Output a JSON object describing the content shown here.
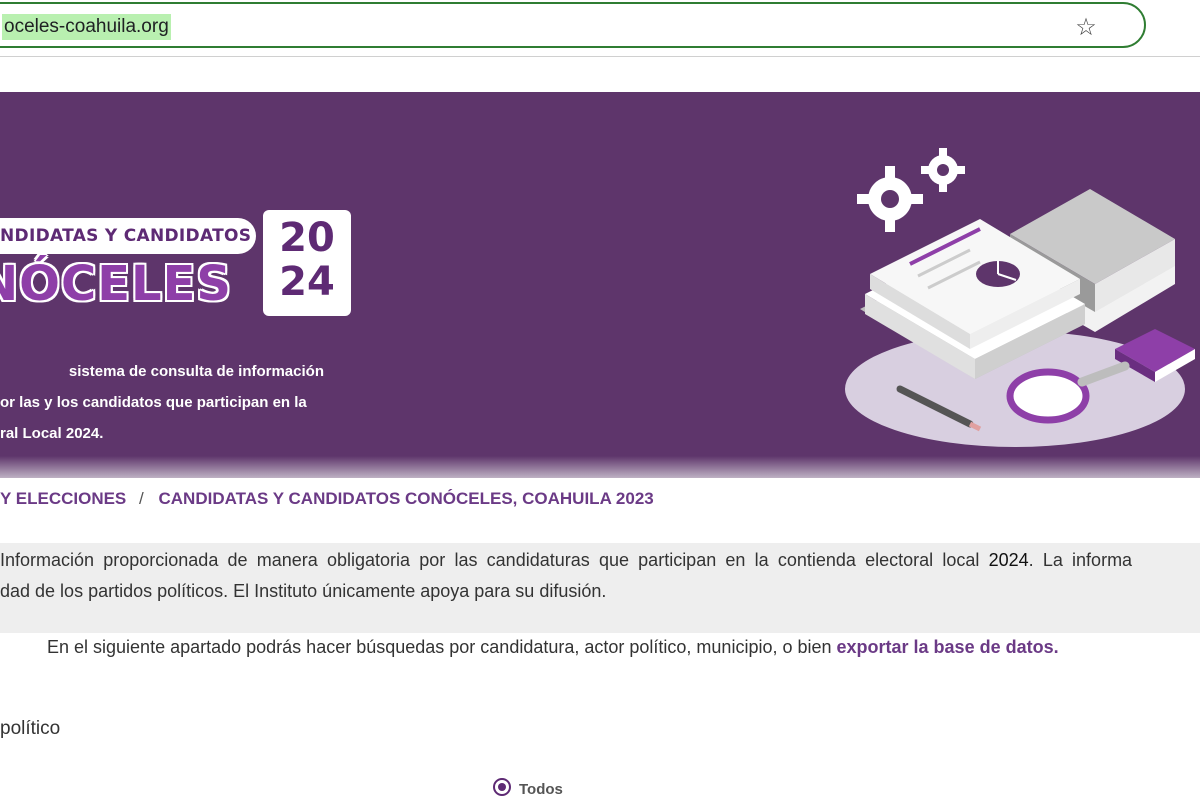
{
  "browser": {
    "url": "oceles-coahuila.org",
    "bookmark_icon": "star-icon"
  },
  "banner": {
    "pill_text": "NDIDATAS Y CANDIDATOS",
    "title": "NÓCELES",
    "year_line1": "20",
    "year_line2": "24",
    "description_lines": [
      "sistema de consulta de información",
      "or las y los candidatos que participan en la",
      "ral Local 2024."
    ],
    "illustration_icons": [
      "gears-icon",
      "documents-icon",
      "pie-chart-icon",
      "books-icon",
      "magnifier-icon",
      "pencil-icon"
    ]
  },
  "breadcrumb": {
    "items": [
      "Y ELECCIONES",
      "CANDIDATAS Y CANDIDATOS CONÓCELES, COAHUILA 2023"
    ],
    "separator": "/"
  },
  "notice": {
    "line1_before": "Información proporcionada de manera obligatoria por las candidaturas que participan en la contienda electoral local ",
    "line1_number": "2024",
    "line1_after": ". La informa",
    "line2": "dad de los partidos políticos. El Instituto únicamente apoya para su difusión."
  },
  "intro": {
    "text": "En el siguiente apartado podrás hacer búsquedas por candidatura, actor político, municipio, o bien ",
    "link": "exportar la base de datos."
  },
  "filter": {
    "section_label": "político",
    "option_label": "Todos",
    "option_selected": true
  },
  "colors": {
    "brand_purple": "#5e356b",
    "accent_purple": "#8e3fa8",
    "link_purple": "#6b3a86",
    "url_highlight": "#b9f0b0"
  }
}
